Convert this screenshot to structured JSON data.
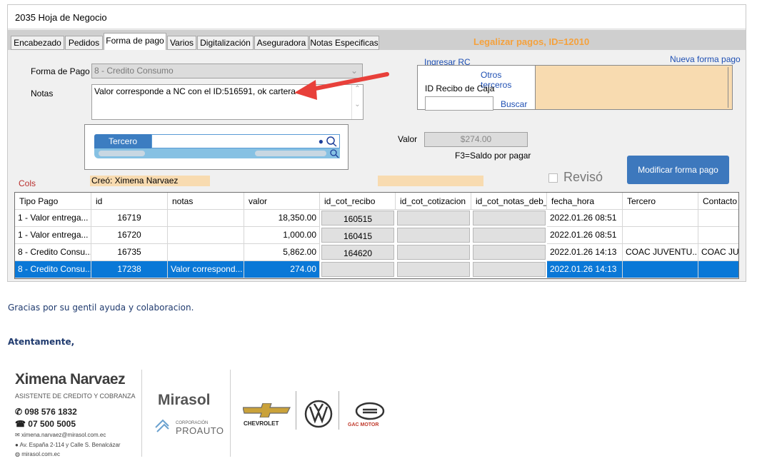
{
  "window": {
    "title": "2035 Hoja de Negocio"
  },
  "tabs": [
    "Encabezado",
    "Pedidos",
    "Forma de pago",
    "Varios",
    "Digitalización",
    "Aseguradora",
    "Notas Especificas"
  ],
  "header_notice": "Legalizar pagos, ID=12010",
  "form": {
    "forma_pago_label": "Forma de Pago",
    "forma_pago_value": "8 - Credito Consumo",
    "notas_label": "Notas",
    "notas_value": "Valor corresponde a NC con el ID:516591, ok cartera",
    "tercero_label": "Tercero",
    "valor_label": "Valor",
    "valor_value": "$274.00",
    "saldo_hint": "F3=Saldo por pagar",
    "revisado_label": "Revisó",
    "cols_label": "Cols",
    "creo_label": "Creó: Ximena Narvaez",
    "modificar_label": "Modificar forma pago"
  },
  "rc": {
    "ingresar_label": "Ingresar RC",
    "nueva_label": "Nueva forma pago",
    "otros_label": "Otros terceros",
    "id_recibo_label": "ID Recibo de Caja",
    "buscar_label": "Buscar"
  },
  "grid": {
    "columns": [
      "Tipo Pago",
      "id",
      "notas",
      "valor",
      "id_cot_recibo",
      "id_cot_cotizacion",
      "id_cot_notas_deb_",
      "fecha_hora",
      "Tercero",
      "Contacto"
    ],
    "rows": [
      {
        "tipo": "1 - Valor entrega...",
        "id": "16719",
        "notas": "",
        "valor": "18,350.00",
        "recibo": "160515",
        "cotizacion": "",
        "notas_deb": "",
        "fecha": "2022.01.26 08:51",
        "tercero": "",
        "contacto": ""
      },
      {
        "tipo": "1 - Valor entrega...",
        "id": "16720",
        "notas": "",
        "valor": "1,000.00",
        "recibo": "160415",
        "cotizacion": "",
        "notas_deb": "",
        "fecha": "2022.01.26 08:51",
        "tercero": "",
        "contacto": ""
      },
      {
        "tipo": "8 - Credito Consu...",
        "id": "16735",
        "notas": "",
        "valor": "5,862.00",
        "recibo": "164620",
        "cotizacion": "",
        "notas_deb": "",
        "fecha": "2022.01.26 14:13",
        "tercero": "COAC JUVENTU...",
        "contacto": "COAC JU"
      },
      {
        "tipo": "8 - Credito Consu...",
        "id": "17238",
        "notas": "Valor correspond...",
        "valor": "274.00",
        "recibo": "",
        "cotizacion": "",
        "notas_deb": "",
        "fecha": "2022.01.26 14:13",
        "tercero": "",
        "contacto": "",
        "selected": true
      }
    ]
  },
  "email": {
    "gracias": "Gracias por su gentil ayuda y colaboracion.",
    "atentamente": "Atentamente,"
  },
  "signature": {
    "name": "Ximena Narvaez",
    "role": "ASISTENTE DE CREDITO Y COBRANZA",
    "phone1": "098 576 1832",
    "phone2": "07 500 5005",
    "email": "ximena.narvaez@mirasol.com.ec",
    "address": "Av. España 2-114 y Calle S. Benalcázar",
    "web": "mirasol.com.ec",
    "brand": "Mirasol",
    "corp_small": "CORPORACIÓN",
    "corp": "PROAUTO",
    "chevrolet": "CHEVROLET",
    "gac": "GAC MOTOR"
  },
  "colors": {
    "accent": "#3d78bd",
    "selected_row": "#0a78d7",
    "arrow": "#e8403a",
    "notice": "#f5a13c",
    "rc_bg": "#f8dbb0"
  }
}
